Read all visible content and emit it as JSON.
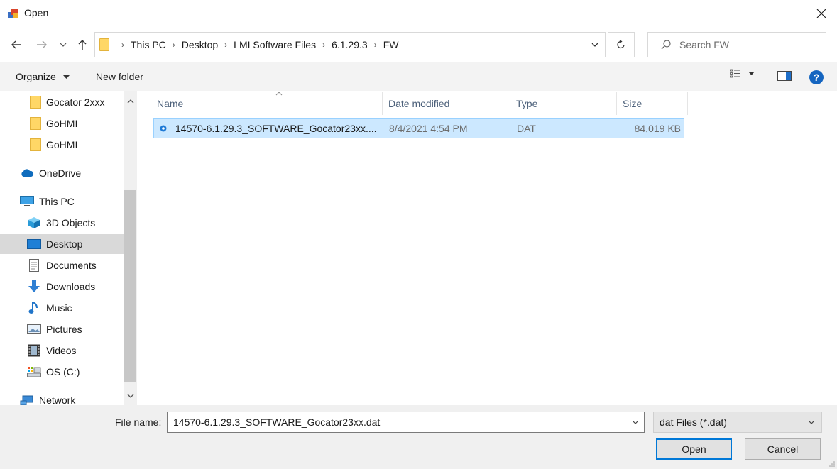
{
  "window": {
    "title": "Open",
    "close_icon": "close-icon",
    "app_icon": "application-icon"
  },
  "nav": {
    "back_icon": "back-arrow-icon",
    "forward_icon": "forward-arrow-icon",
    "recent_icon": "chevron-down-icon",
    "up_icon": "up-arrow-icon",
    "breadcrumbs": [
      "This PC",
      "Desktop",
      "LMI Software Files",
      "6.1.29.3",
      "FW"
    ],
    "refresh_icon": "refresh-icon",
    "search_placeholder": "Search FW"
  },
  "toolbar": {
    "organize_label": "Organize",
    "new_folder_label": "New folder"
  },
  "sidebar": {
    "items": [
      {
        "label": "Gocator 2xxx",
        "icon": "folder-icon"
      },
      {
        "label": "GoHMI",
        "icon": "folder-icon"
      },
      {
        "label": "GoHMI",
        "icon": "folder-icon"
      },
      {
        "label": "OneDrive",
        "icon": "cloud-icon"
      },
      {
        "label": "This PC",
        "icon": "computer-icon"
      },
      {
        "label": "3D Objects",
        "icon": "cube-icon"
      },
      {
        "label": "Desktop",
        "icon": "desktop-icon"
      },
      {
        "label": "Documents",
        "icon": "document-icon"
      },
      {
        "label": "Downloads",
        "icon": "download-icon"
      },
      {
        "label": "Music",
        "icon": "music-icon"
      },
      {
        "label": "Pictures",
        "icon": "pictures-icon"
      },
      {
        "label": "Videos",
        "icon": "videos-icon"
      },
      {
        "label": "OS (C:)",
        "icon": "drive-icon"
      },
      {
        "label": "Network",
        "icon": "network-icon"
      }
    ],
    "selected": "Desktop"
  },
  "columns": {
    "name": "Name",
    "date": "Date modified",
    "type": "Type",
    "size": "Size"
  },
  "files": [
    {
      "name": "14570-6.1.29.3_SOFTWARE_Gocator23xx....",
      "date": "8/4/2021 4:54 PM",
      "type": "DAT",
      "size": "84,019 KB"
    }
  ],
  "footer": {
    "file_name_label": "File name:",
    "file_name_value": "14570-6.1.29.3_SOFTWARE_Gocator23xx.dat",
    "file_type_value": "dat Files (*.dat)",
    "open_label": "Open",
    "cancel_label": "Cancel"
  },
  "colors": {
    "selection_bg": "#cce8ff",
    "selection_border": "#99d1ff",
    "accent": "#0078d7",
    "folder": "#ffd766"
  }
}
